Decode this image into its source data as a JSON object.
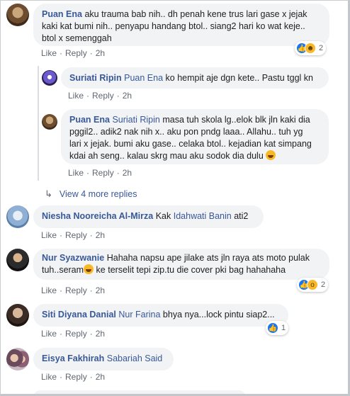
{
  "colors": {
    "link": "#385898",
    "bubble": "#f2f3f5",
    "meta": "#606770",
    "like": "#1877f2",
    "emoji": "#f7b928"
  },
  "comments": [
    {
      "name": "Puan Ena",
      "text": "aku trauma bab nih.. dh penah kene trus lari gase x jejak kaki kat bumi nih.. penyapu handang btol.. siang2 hari ko wat keje.. btol x semenggah",
      "line1_rest": "aku trauma bab nih.. dh penah kene trus lari gase x jejak",
      "line2": "kaki kat bumi nih.. penyapu handang btol.. siang2 hari ko wat keje..",
      "line3": "btol x semenggah",
      "like": "Like",
      "reply": "Reply",
      "time": "2h",
      "reaction_icons": [
        "like-icon",
        "haha-icon"
      ],
      "reaction_count": "2"
    },
    {
      "name": "Suriati Ripin",
      "mention": "Puan Ena",
      "text": "ko hempit aje dgn kete.. Pastu tggl kn",
      "like": "Like",
      "reply": "Reply",
      "time": "2h"
    },
    {
      "name": "Puan Ena",
      "mention": "Suriati Ripin",
      "line1_rest": "masa tuh skola lg..elok blk jln kaki dia",
      "line2": "pggil2.. adik2 nak nih x.. aku pon pndg laaa.. Allahu.. tuh yg",
      "line3": "lari x jejak. bumi aku gase.. celaka btol.. kejadian kat simpang",
      "line4": "kdai ah seng.. kalau skrg mau aku sodok dia dulu",
      "like": "Like",
      "reply": "Reply",
      "time": "2h"
    },
    {
      "name": "Niesha Nooreicha Al-Mirza",
      "prefix": "Kak",
      "mention": "Idahwati Banin",
      "text": "ati2",
      "like": "Like",
      "reply": "Reply",
      "time": "2h"
    },
    {
      "name": "Nur Syazwanie",
      "line1_rest": "Hahaha napsu ape jilake ats jln raya ats moto pulak",
      "line2_a": "tuh..seram",
      "line2_b": "ke terselit tepi zip.tu die cover pki bag hahahaha",
      "like": "Like",
      "reply": "Reply",
      "time": "2h",
      "reaction_icons": [
        "like-icon",
        "wow-icon"
      ],
      "reaction_count": "2"
    },
    {
      "name": "Siti Diyana Danial",
      "mention": "Nur Farina",
      "text": "bhya nya...lock pintu siap2...",
      "like": "Like",
      "reply": "Reply",
      "time": "2h",
      "reaction_icons": [
        "like-icon"
      ],
      "reaction_count": "1"
    },
    {
      "name": "Eisya Fakhirah",
      "mention": "Sabariah Said",
      "like": "Like",
      "reply": "Reply",
      "time": "2h"
    }
  ],
  "view_more": "View 4 more replies"
}
